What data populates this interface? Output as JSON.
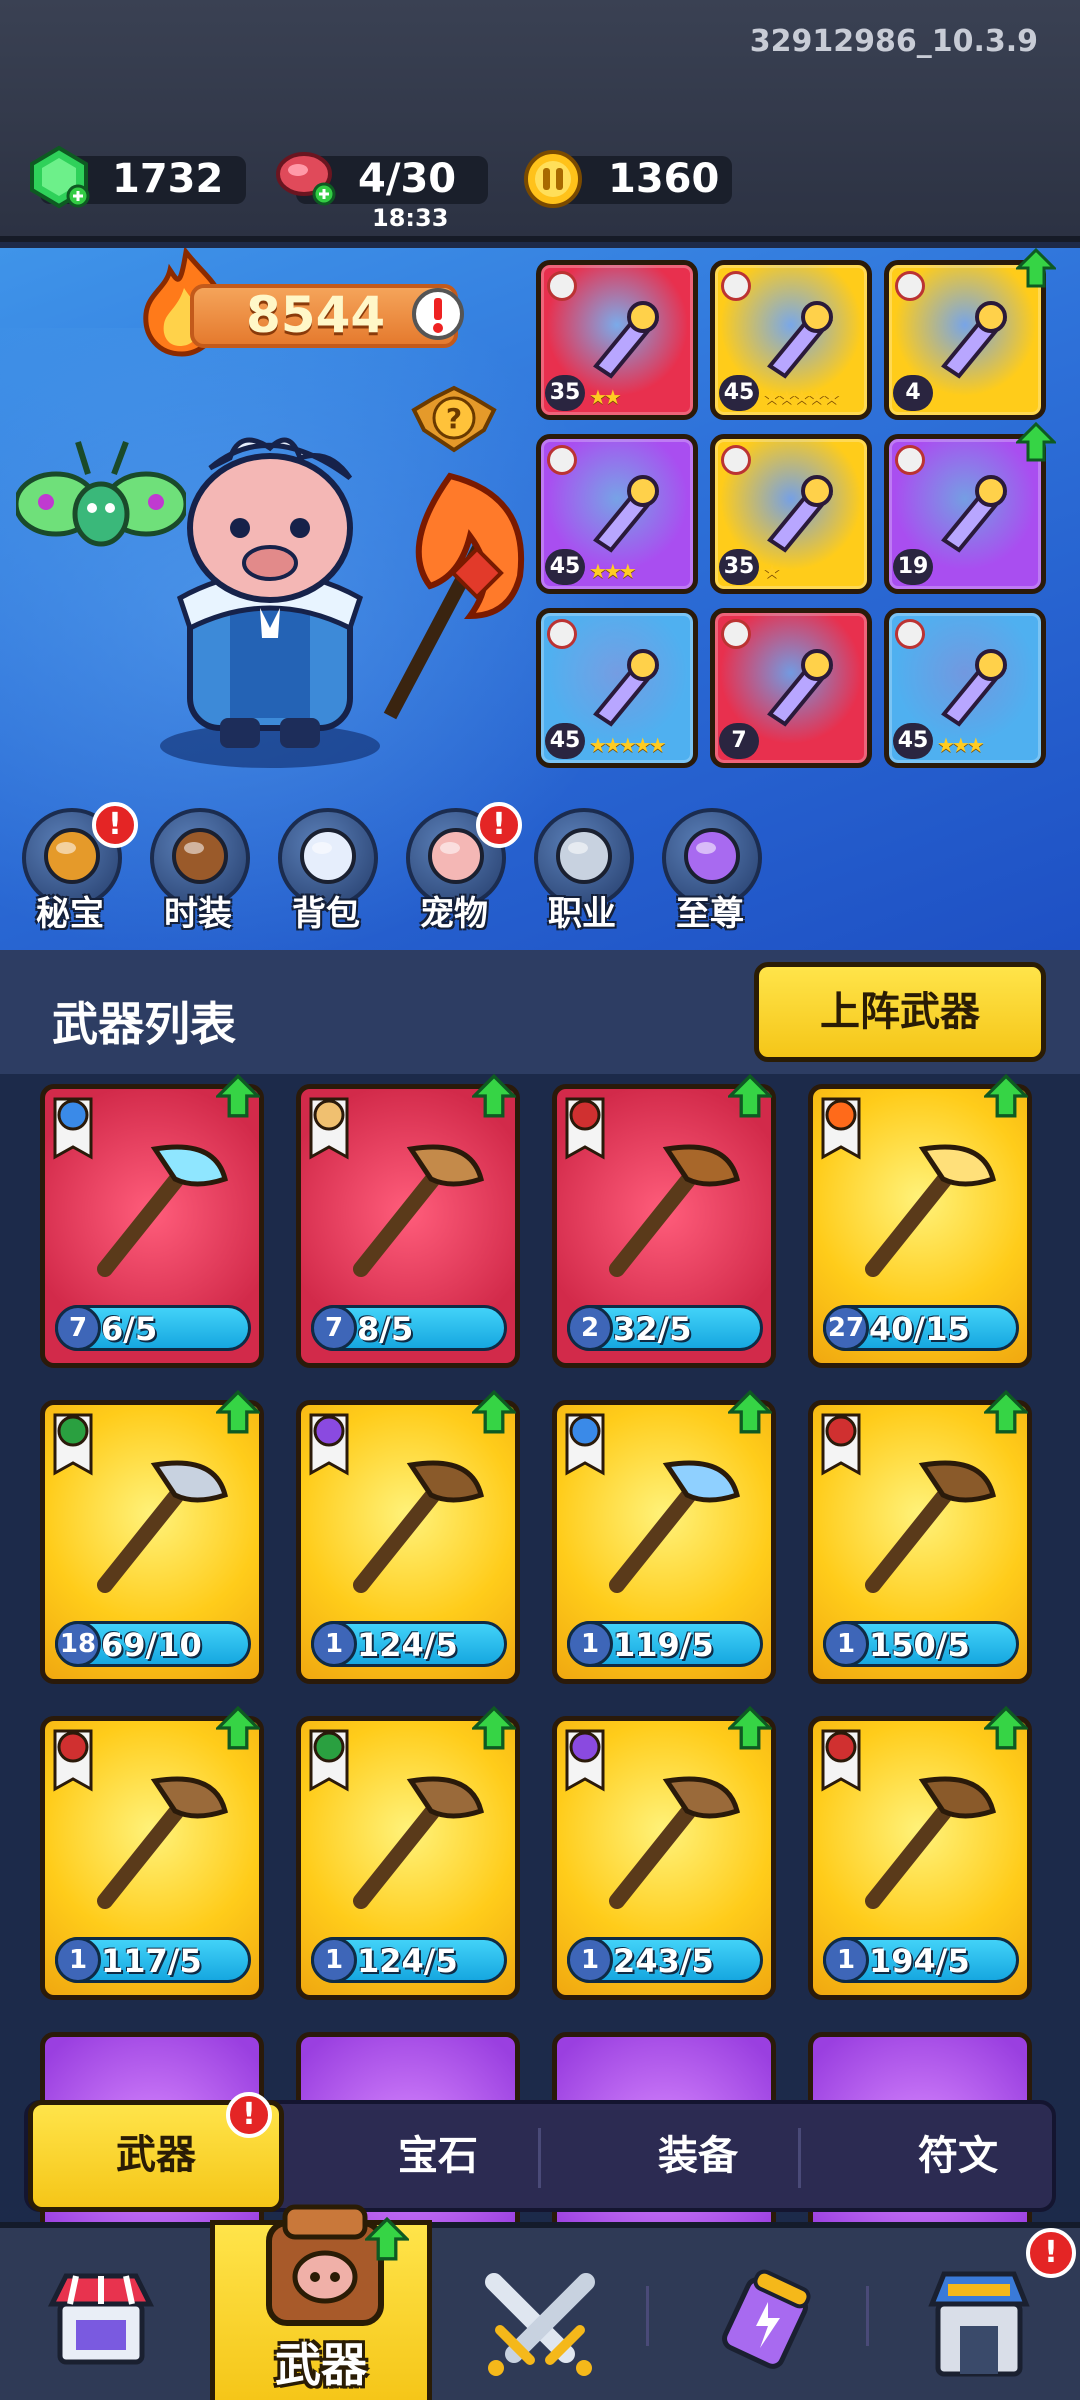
{
  "build_version": "32912986_10.3.9",
  "resources": {
    "gems": {
      "value": "1732",
      "icon": "gem-icon"
    },
    "stamina": {
      "value": "4/30",
      "timer": "18:33",
      "icon": "meat-icon"
    },
    "coins": {
      "value": "1360",
      "icon": "coin-icon"
    }
  },
  "hero": {
    "power": "8544",
    "equipment": [
      {
        "level": "35",
        "stars": "★★",
        "color": "#e8304e"
      },
      {
        "level": "45",
        "stars": "★★★★★",
        "color": "#ffcc1a"
      },
      {
        "level": "4",
        "stars": "",
        "color": "#ffcc1a"
      },
      {
        "level": "45",
        "stars": "★★★",
        "color": "#a94ef0"
      },
      {
        "level": "35",
        "stars": "★",
        "color": "#ffcc1a"
      },
      {
        "level": "19",
        "stars": "",
        "color": "#a94ef0"
      },
      {
        "level": "45",
        "stars": "★★★★★",
        "color": "#4fb0f0"
      },
      {
        "level": "7",
        "stars": "",
        "color": "#e8304e"
      },
      {
        "level": "45",
        "stars": "★★★",
        "color": "#4fb0f0"
      }
    ]
  },
  "menu": [
    {
      "label": "秘宝",
      "alert": "!"
    },
    {
      "label": "时装",
      "alert": ""
    },
    {
      "label": "背包",
      "alert": ""
    },
    {
      "label": "宠物",
      "alert": "!"
    },
    {
      "label": "职业",
      "alert": ""
    },
    {
      "label": "至尊",
      "alert": ""
    }
  ],
  "weapon_list": {
    "title": "武器列表",
    "deploy_button": "上阵武器",
    "cards": [
      {
        "level": "7",
        "count": "6/5",
        "rarity": "red"
      },
      {
        "level": "7",
        "count": "8/5",
        "rarity": "red"
      },
      {
        "level": "2",
        "count": "32/5",
        "rarity": "red"
      },
      {
        "level": "27",
        "count": "40/15",
        "rarity": "gold"
      },
      {
        "level": "18",
        "count": "69/10",
        "rarity": "gold"
      },
      {
        "level": "1",
        "count": "124/5",
        "rarity": "gold"
      },
      {
        "level": "1",
        "count": "119/5",
        "rarity": "gold"
      },
      {
        "level": "1",
        "count": "150/5",
        "rarity": "gold"
      },
      {
        "level": "1",
        "count": "117/5",
        "rarity": "gold"
      },
      {
        "level": "1",
        "count": "124/5",
        "rarity": "gold"
      },
      {
        "level": "1",
        "count": "243/5",
        "rarity": "gold"
      },
      {
        "level": "1",
        "count": "194/5",
        "rarity": "gold"
      }
    ]
  },
  "sub_tabs": {
    "weapon": "武器",
    "gem": "宝石",
    "equipment": "装备",
    "rune": "符文",
    "weapon_alert": "!"
  },
  "bottom_nav": {
    "active_label": "武器",
    "alert": "!"
  },
  "colors": {
    "accent_yellow": "#f5c618",
    "hero_bg": "#2f73da",
    "alert_red": "#e42525"
  }
}
